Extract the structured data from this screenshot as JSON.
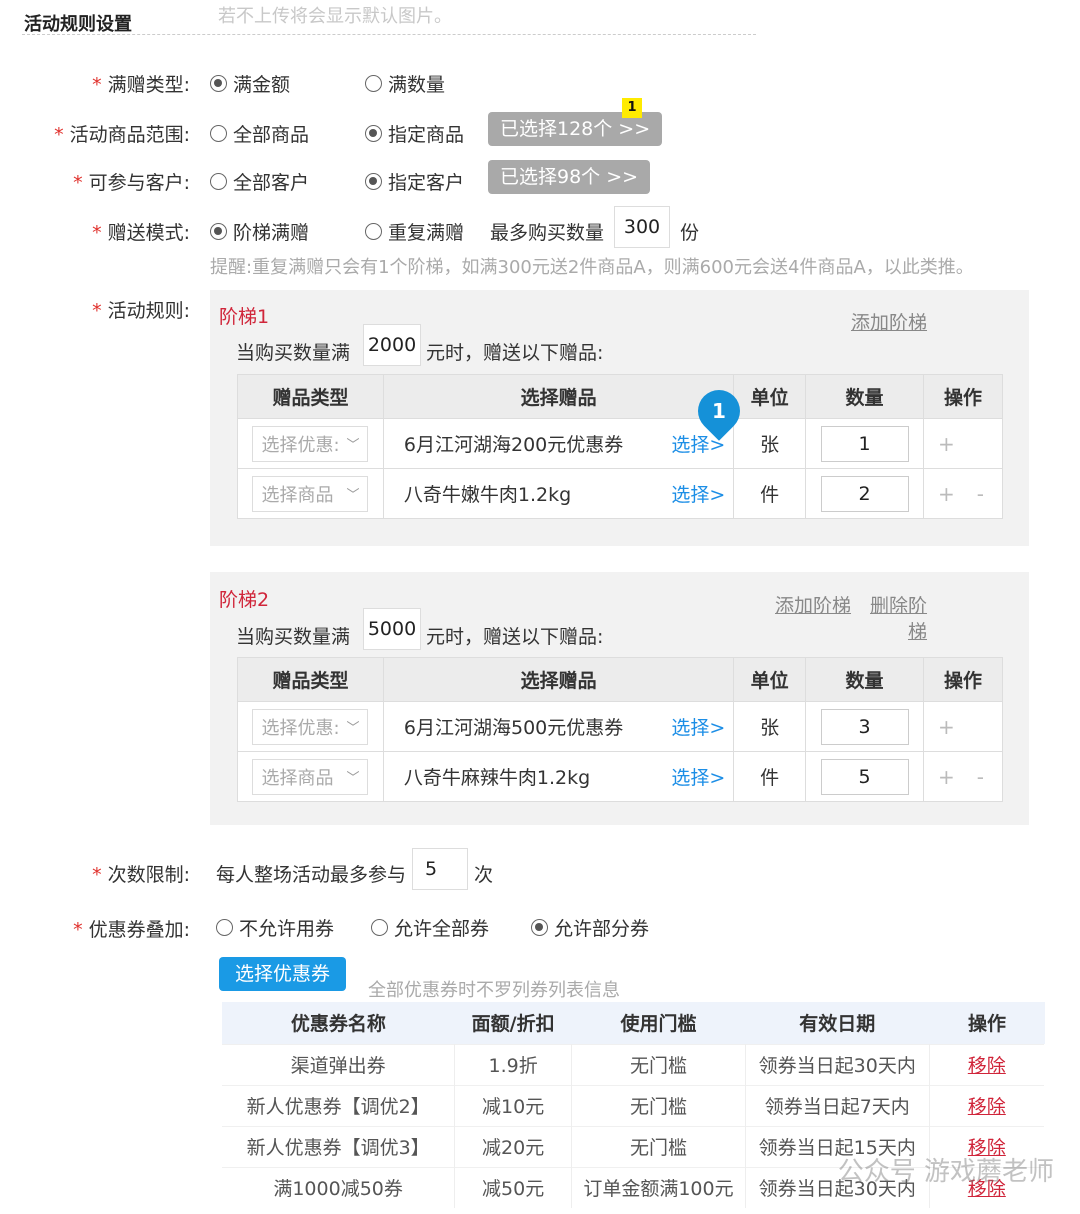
{
  "section": {
    "title": "活动规则设置",
    "faded_hint": "若不上传将会显示默认图片。"
  },
  "gift_type": {
    "label": "满赠类型:",
    "options": [
      "满金额",
      "满数量"
    ],
    "selected": 0
  },
  "product_scope": {
    "label": "活动商品范围:",
    "options": [
      "全部商品",
      "指定商品"
    ],
    "selected": 1,
    "chosen_button": "已选择128个 >>",
    "badge": "1"
  },
  "customers": {
    "label": "可参与客户:",
    "options": [
      "全部客户",
      "指定客户"
    ],
    "selected": 1,
    "chosen_button": "已选择98个 >>"
  },
  "gift_mode": {
    "label": "赠送模式:",
    "options": [
      "阶梯满赠",
      "重复满赠"
    ],
    "selected": 0,
    "max_qty_label": "最多购买数量",
    "max_qty_value": "300",
    "max_qty_unit": "份",
    "tip": "提醒:重复满赠只会有1个阶梯，如满300元送2件商品A，则满600元会送4件商品A，以此类推。"
  },
  "rules": {
    "label": "活动规则:",
    "table_headers": [
      "赠品类型",
      "选择赠品",
      "单位",
      "数量",
      "操作"
    ],
    "tiers": [
      {
        "name": "阶梯1",
        "condition_prefix": "当购买数量满",
        "threshold": "2000",
        "condition_suffix": "元时，赠送以下赠品:",
        "links": [
          "添加阶梯"
        ],
        "rows": [
          {
            "type": "选择优惠:",
            "gift": "6月江河湖海200元优惠券",
            "pick": "选择>",
            "unit": "张",
            "qty": "1",
            "ops": [
              "+"
            ]
          },
          {
            "type": "选择商品",
            "gift": "八奇牛嫩牛肉1.2kg",
            "pick": "选择>",
            "unit": "件",
            "qty": "2",
            "ops": [
              "+",
              "-"
            ]
          }
        ],
        "pin": "1"
      },
      {
        "name": "阶梯2",
        "condition_prefix": "当购买数量满",
        "threshold": "5000",
        "condition_suffix": "元时，赠送以下赠品:",
        "links": [
          "添加阶梯",
          "删除阶",
          "梯"
        ],
        "rows": [
          {
            "type": "选择优惠:",
            "gift": "6月江河湖海500元优惠券",
            "pick": "选择>",
            "unit": "张",
            "qty": "3",
            "ops": [
              "+"
            ]
          },
          {
            "type": "选择商品",
            "gift": "八奇牛麻辣牛肉1.2kg",
            "pick": "选择>",
            "unit": "件",
            "qty": "5",
            "ops": [
              "+",
              "-"
            ]
          }
        ]
      }
    ]
  },
  "limit": {
    "label": "次数限制:",
    "prefix": "每人整场活动最多参与",
    "value": "5",
    "suffix": "次"
  },
  "coupon_stack": {
    "label": "优惠券叠加:",
    "options": [
      "不允许用券",
      "允许全部券",
      "允许部分券"
    ],
    "selected": 2,
    "select_button": "选择优惠券",
    "hint": "全部优惠券时不罗列券列表信息",
    "headers": [
      "优惠券名称",
      "面额/折扣",
      "使用门槛",
      "有效日期",
      "操作"
    ],
    "rows": [
      [
        "渠道弹出券",
        "1.9折",
        "无门槛",
        "领券当日起30天内",
        "移除"
      ],
      [
        "新人优惠券【调优2】",
        "减10元",
        "无门槛",
        "领券当日起7天内",
        "移除"
      ],
      [
        "新人优惠券【调优3】",
        "减20元",
        "无门槛",
        "领券当日起15天内",
        "移除"
      ],
      [
        "满1000减50券",
        "减50元",
        "订单金额满100元",
        "领券当日起30天内",
        "移除"
      ]
    ]
  },
  "watermark": "公众号 游戏蘑老师"
}
